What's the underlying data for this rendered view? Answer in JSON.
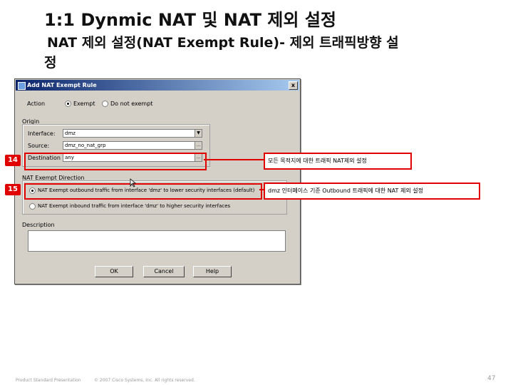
{
  "slide": {
    "title": "1:1 Dynmic NAT 및 NAT 제외 설정",
    "subtitle_line1": "NAT 제외 설정(NAT Exempt Rule)- 제외 트래픽방향 설",
    "subtitle_line2": "정",
    "footer_left": "Product Standard Presentation",
    "footer_center": "© 2007 Cisco Systems, Inc. All rights reserved.",
    "page_number": "47"
  },
  "dialog": {
    "title": "Add NAT Exempt Rule",
    "close_label": "x",
    "action": {
      "label": "Action",
      "exempt_label": "Exempt",
      "donot_label": "Do not exempt",
      "selected": "Exempt"
    },
    "origin": {
      "legend": "Origin",
      "interface_label": "Interface:",
      "interface_value": "dmz",
      "source_label": "Source:",
      "source_value": "dmz_no_nat_grp",
      "destination_label": "Destination",
      "destination_value": "any"
    },
    "direction": {
      "legend": "NAT Exempt Direction",
      "outbound_label": "NAT Exempt outbound traffic from interface 'dmz' to lower security interfaces (default)",
      "inbound_label": "NAT Exempt inbound traffic from interface 'dmz' to higher security interfaces",
      "selected": "outbound"
    },
    "description": {
      "label": "Description",
      "value": ""
    },
    "buttons": {
      "ok": "OK",
      "cancel": "Cancel",
      "help": "Help"
    }
  },
  "callouts": [
    {
      "number": "14",
      "text": "모든 목적지에 대한 트래픽 NAT제외 설정"
    },
    {
      "number": "15",
      "text": "dmz 인터페이스 기준 Outbound 트래픽에 대한 NAT 제외 설정"
    }
  ],
  "colors": {
    "highlight": "#e00000",
    "titlebar": "#0a246a",
    "dialog_bg": "#d4d0c8"
  }
}
